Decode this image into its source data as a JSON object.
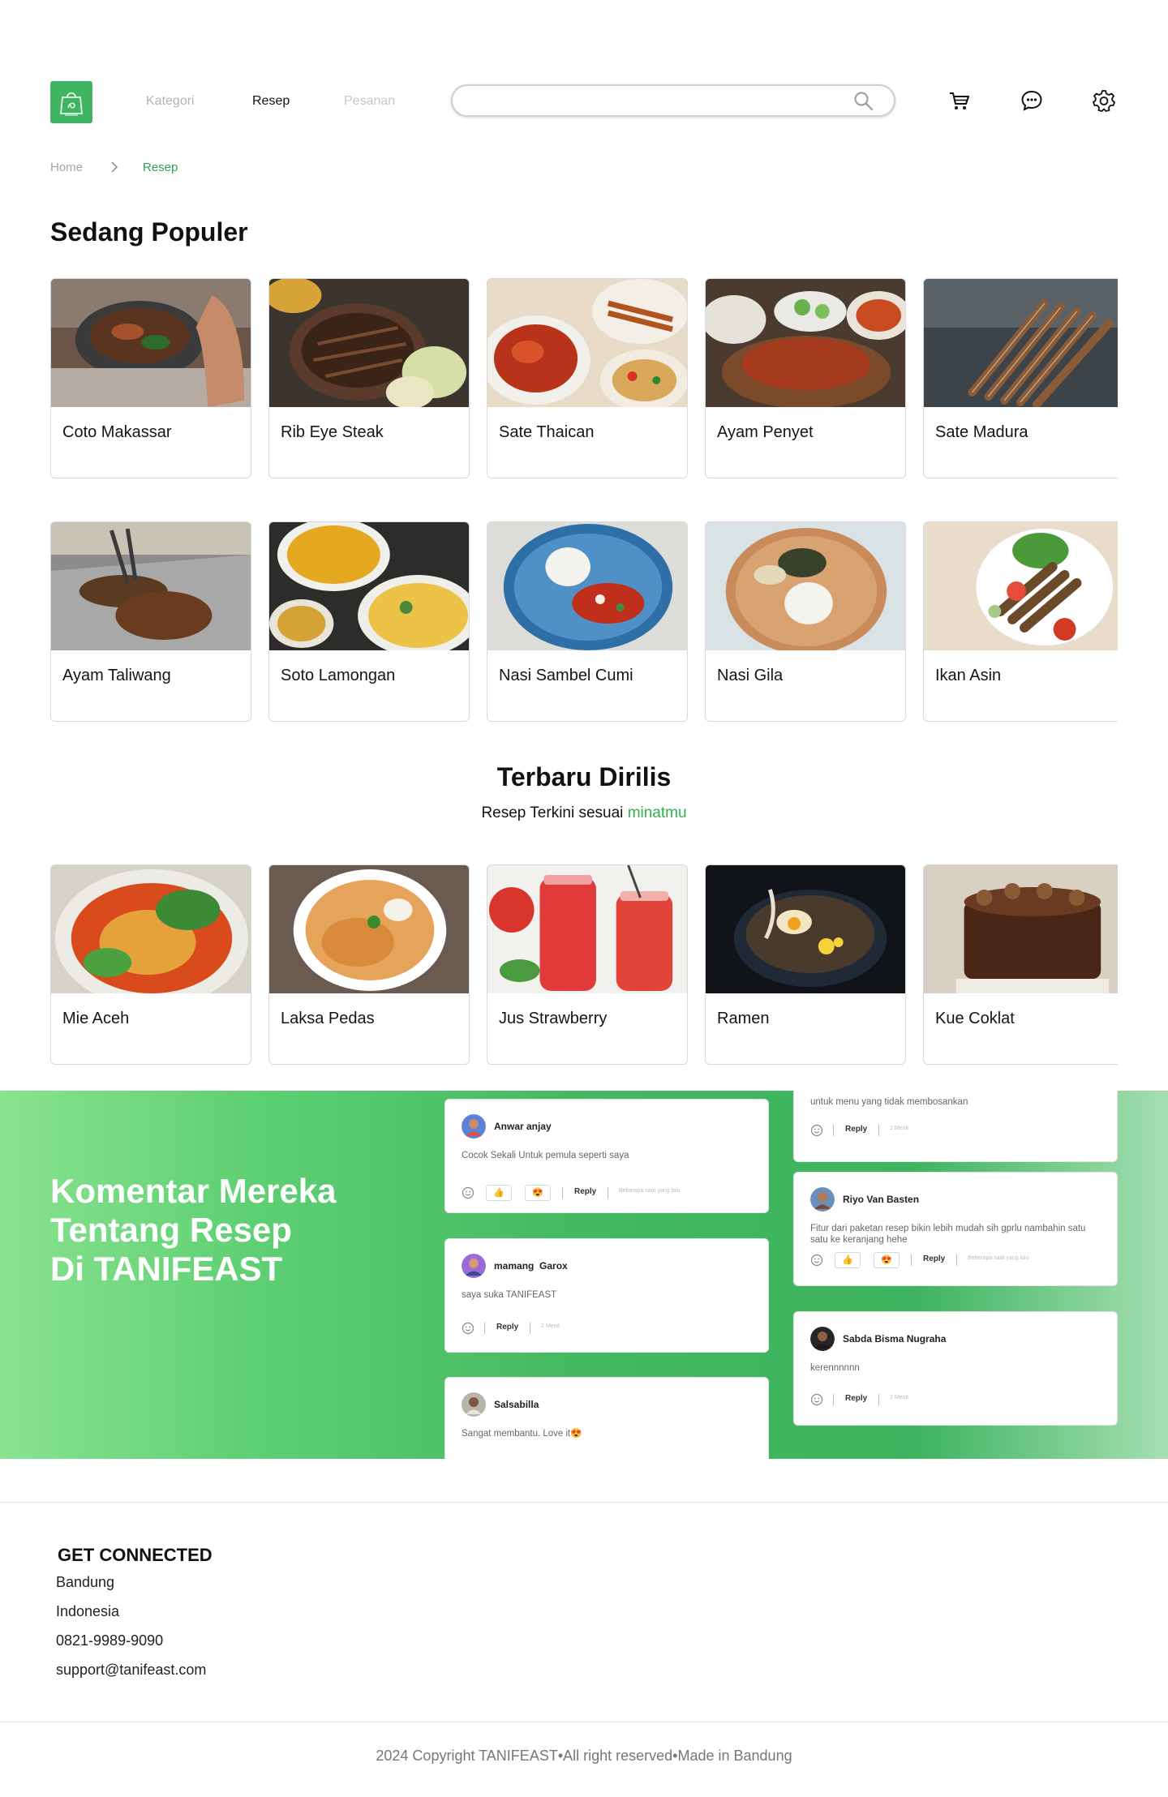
{
  "nav": {
    "links": [
      "Kategori",
      "Resep",
      "Pesanan"
    ],
    "search_placeholder": "",
    "colors": {
      "brand": "#3fb562",
      "active_text": "#111111",
      "inactive_text": "#b3b3b3"
    }
  },
  "breadcrumb": {
    "home": "Home",
    "current": "Resep"
  },
  "popular": {
    "title": "Sedang Populer",
    "row1": [
      "Coto Makassar",
      "Rib Eye Steak",
      "Sate Thaican",
      "Ayam Penyet",
      "Sate Madura"
    ],
    "row2": [
      "Ayam Taliwang",
      "Soto Lamongan",
      "Nasi Sambel Cumi",
      "Nasi Gila",
      "Ikan Asin"
    ]
  },
  "latest": {
    "title": "Terbaru Dirilis",
    "subtitle_prefix": "Resep Terkini sesuai",
    "subtitle_highlight": "minatmu",
    "items": [
      "Mie Aceh",
      "Laksa Pedas",
      "Jus Strawberry",
      "Ramen",
      "Kue Coklat"
    ]
  },
  "testimonials": {
    "title_lines": [
      "Komentar Mereka",
      "Tentang Resep",
      "Di TANIFEAST"
    ],
    "left_column": [
      {
        "name": "Anwar anjay",
        "text": "Cocok Sekali Untuk pemula seperti saya",
        "reply": "Reply",
        "time": "Beberapa saat yang lalu",
        "reactions": [
          "👍",
          "😍"
        ]
      },
      {
        "name": "mamang  Garox",
        "text": "saya suka TANIFEAST",
        "reply": "Reply",
        "time": "2 Menit"
      },
      {
        "name": "Salsabilla",
        "text": "Sangat membantu. Love it😍"
      }
    ],
    "right_column": [
      {
        "text": "untuk menu yang tidak membosankan",
        "reply": "Reply",
        "time": "2 Menit"
      },
      {
        "name": "Riyo Van Basten",
        "text": "Fitur dari paketan resep bikin lebih mudah sih gprlu nambahin satu satu ke keranjang hehe",
        "reply": "Reply",
        "time": "Beberapa saat yang lalu",
        "reactions": [
          "👍",
          "😍"
        ]
      },
      {
        "name": "Sabda Bisma Nugraha",
        "text": "kerennnnnn",
        "reply": "Reply",
        "time": "2 Menit"
      }
    ]
  },
  "footer": {
    "title": "GET CONNECTED",
    "lines": [
      "Bandung",
      "Indonesia",
      "0821-9989-9090",
      "support@tanifeast.com"
    ],
    "copyright": "2024 Copyright TANIFEAST•All right reserved•Made in Bandung"
  }
}
